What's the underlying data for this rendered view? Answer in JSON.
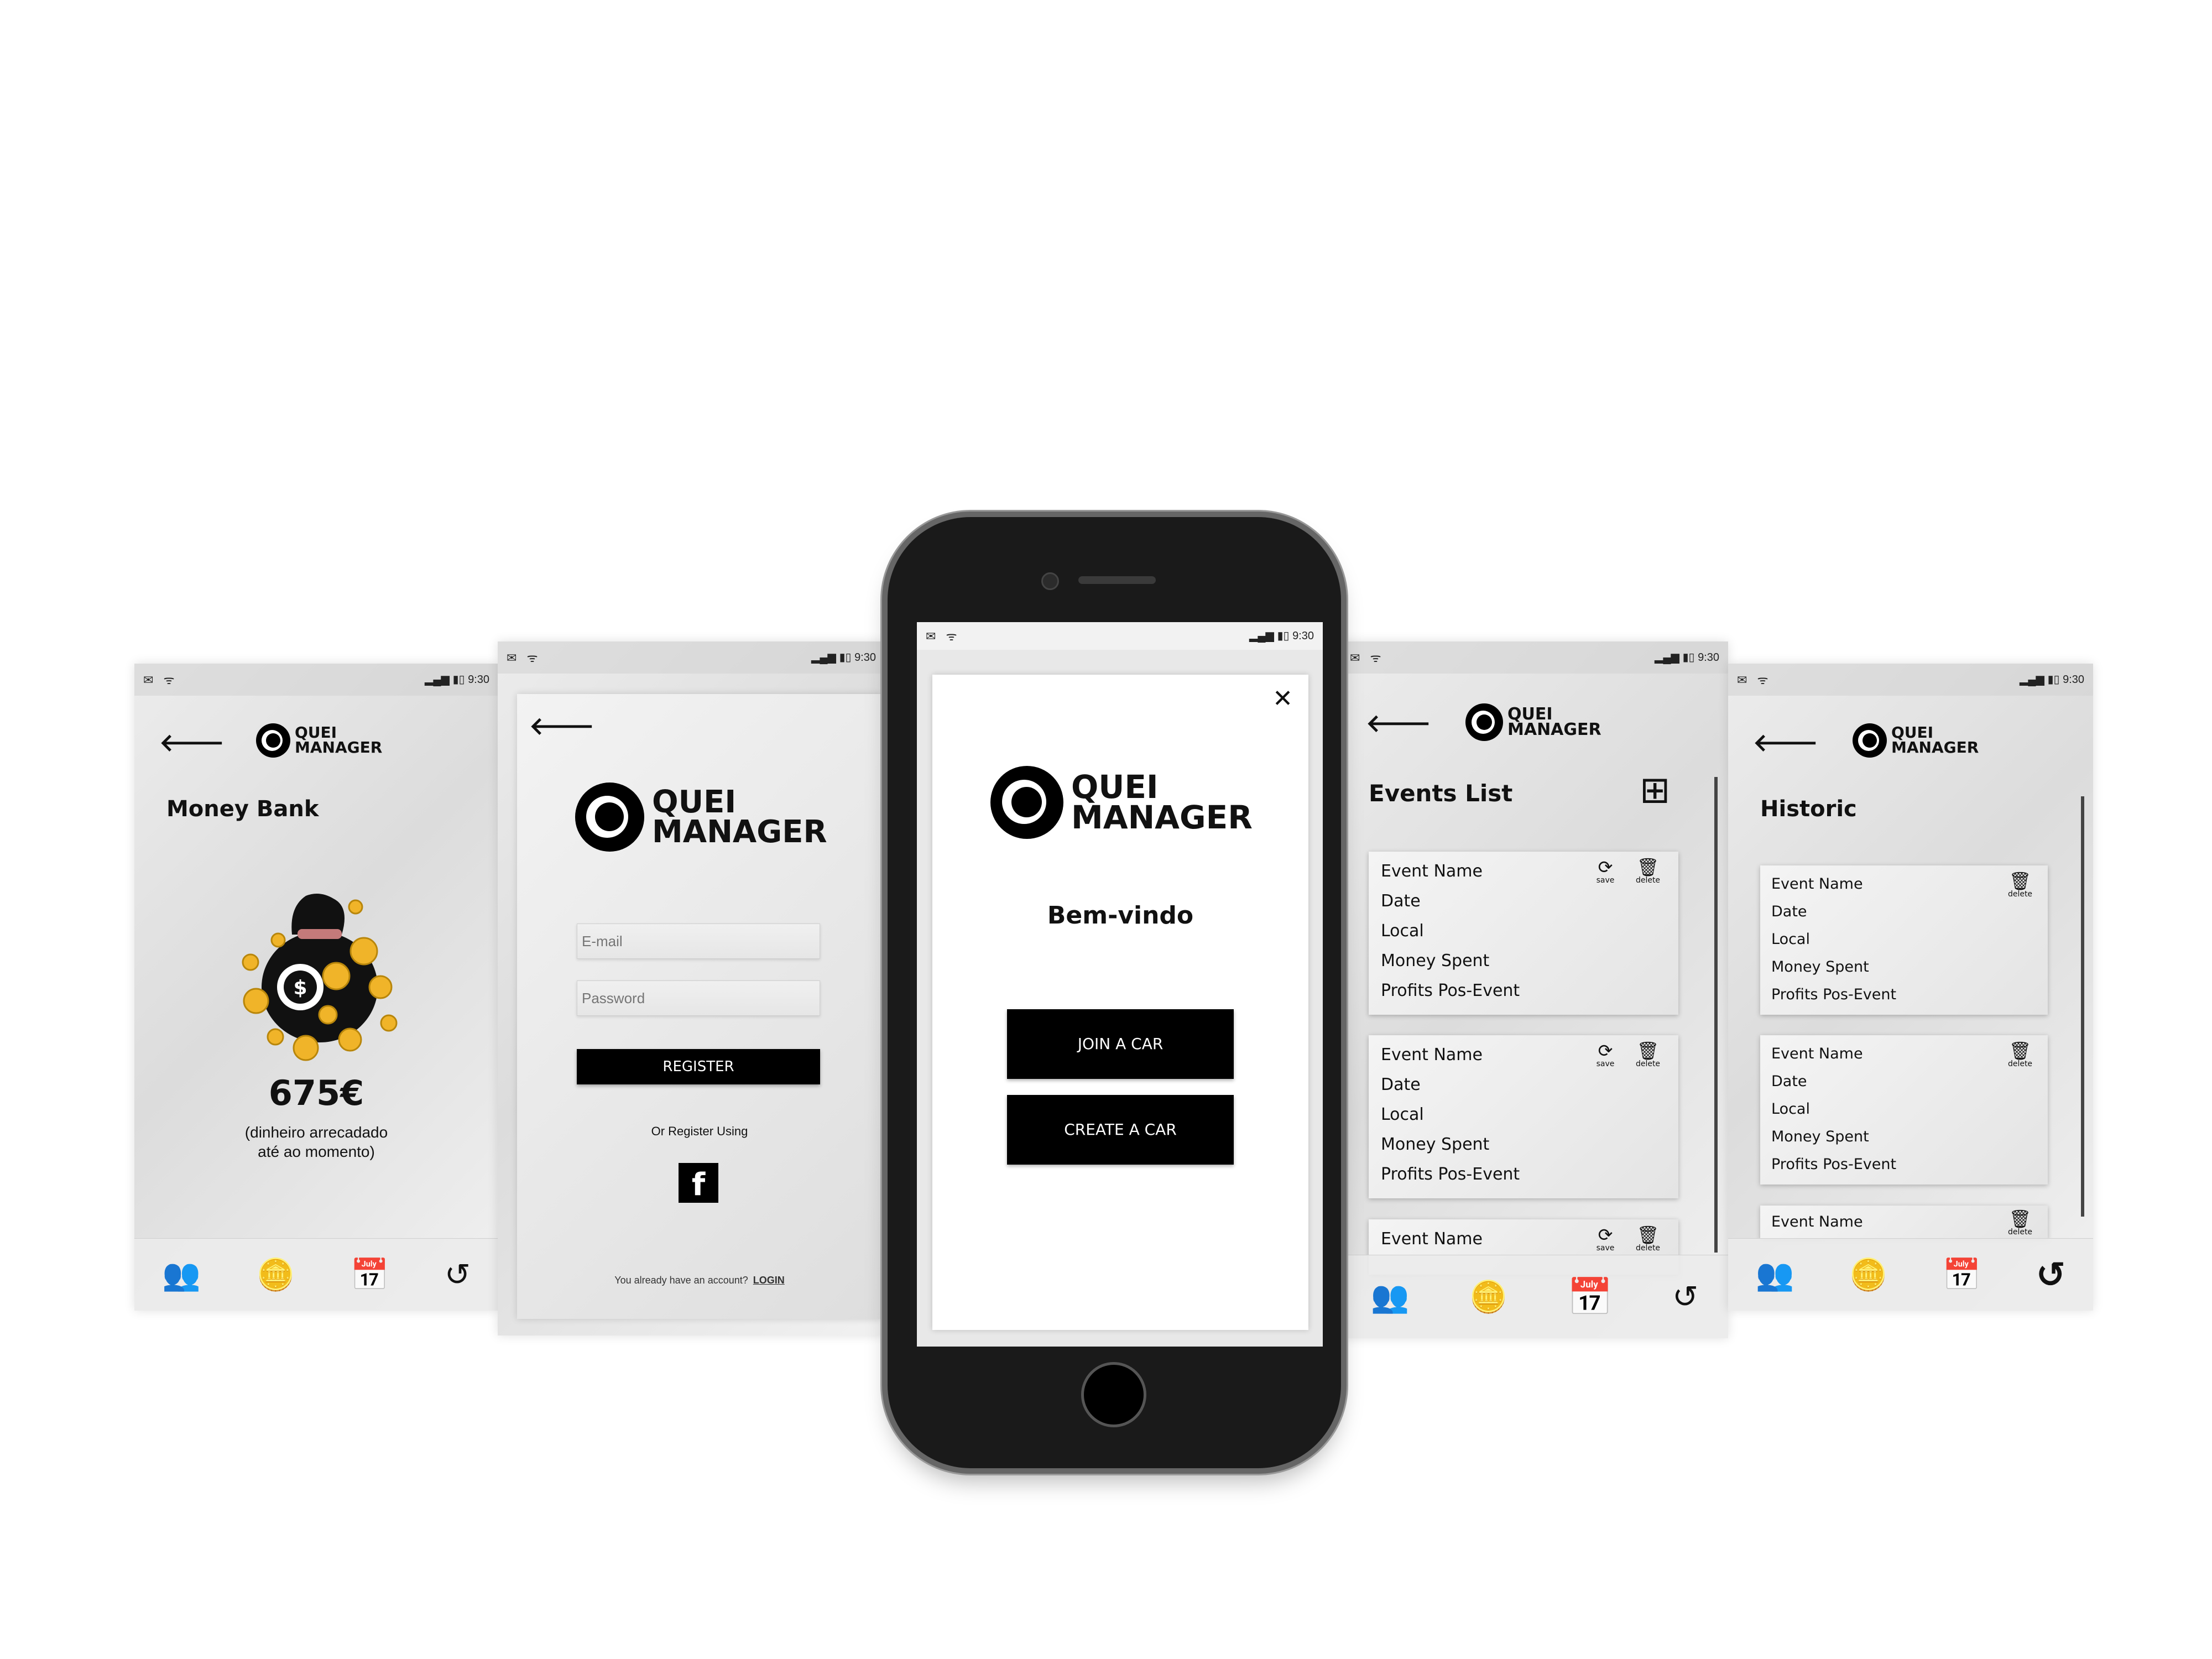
{
  "statusbar": {
    "icons_left": "✉ ᯤ",
    "signal": "▂▄▆",
    "battery": "▮▯",
    "time": "9:30"
  },
  "logo": {
    "line1": "QUEI",
    "line2": "MANAGER"
  },
  "money_bank": {
    "title": "Money Bank",
    "amount": "675€",
    "caption_line1": "(dinheiro arrecadado",
    "caption_line2": "até ao momento)"
  },
  "register": {
    "email_placeholder": "E-mail",
    "password_placeholder": "Password",
    "register_label": "REGISTER",
    "or_register_using": "Or Register Using",
    "facebook_glyph": "f",
    "already_account": "You already have an account?",
    "login_label": "LOGIN"
  },
  "welcome": {
    "close_glyph": "✕",
    "greeting": "Bem-vindo",
    "join_label": "JOIN A CAR",
    "create_label": "CREATE A CAR"
  },
  "events_list": {
    "title": "Events List",
    "add_glyph": "⊞",
    "cards": [
      {
        "name": "Event Name",
        "date": "Date",
        "local": "Local",
        "money": "Money Spent",
        "profits": "Profits Pos-Event",
        "save": "save",
        "delete": "delete"
      },
      {
        "name": "Event Name",
        "date": "Date",
        "local": "Local",
        "money": "Money Spent",
        "profits": "Profits Pos-Event",
        "save": "save",
        "delete": "delete"
      },
      {
        "name": "Event Name",
        "save": "save",
        "delete": "delete"
      }
    ]
  },
  "historic": {
    "title": "Historic",
    "cards": [
      {
        "name": "Event Name",
        "date": "Date",
        "local": "Local",
        "money": "Money Spent",
        "profits": "Profits Pos-Event",
        "delete": "delete"
      },
      {
        "name": "Event Name",
        "date": "Date",
        "local": "Local",
        "money": "Money Spent",
        "profits": "Profits Pos-Event",
        "delete": "delete"
      },
      {
        "name": "Event Name",
        "delete": "delete"
      }
    ]
  },
  "icons": {
    "back": "🡐",
    "refresh": "⟳",
    "trash": "🗑",
    "group": "👥",
    "coins": "🪙",
    "calendar": "📅",
    "history": "↺"
  }
}
